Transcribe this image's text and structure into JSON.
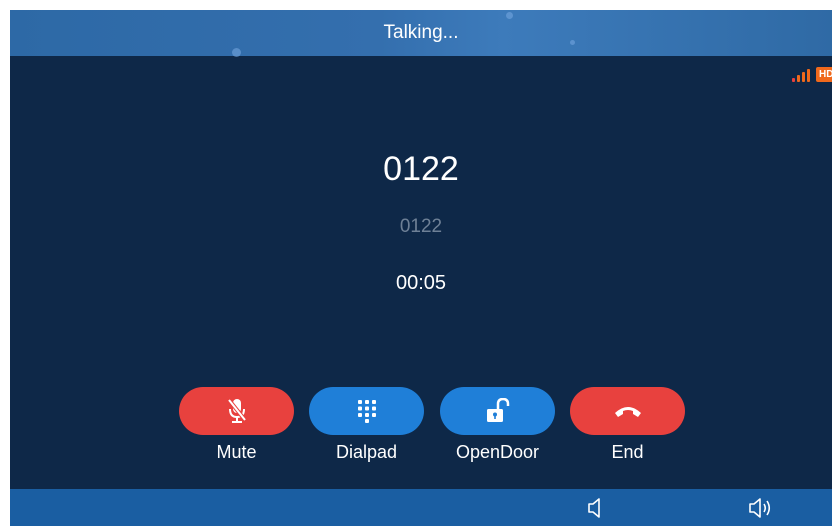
{
  "header": {
    "title": "Talking..."
  },
  "status": {
    "signal_icon": "signal-strength-icon",
    "hd_label": "HD",
    "hd_color": "#f0691c",
    "signal_active_color": "#e8413e",
    "signal_inactive_color": "#f0691c"
  },
  "call": {
    "number": "0122",
    "sub_number": "0122",
    "duration": "00:05"
  },
  "actions": {
    "mute_label": "Mute",
    "mute_icon": "microphone-muted-icon",
    "dialpad_label": "Dialpad",
    "dialpad_icon": "keypad-icon",
    "open_door_label": "OpenDoor",
    "open_door_icon": "unlock-icon",
    "end_label": "End",
    "end_icon": "hang-up-icon"
  },
  "bottom": {
    "volume_down_icon": "speaker-volume-down-icon",
    "volume_up_icon": "speaker-volume-up-icon"
  },
  "colors": {
    "background": "#0e2848",
    "danger": "#e8413e",
    "primary": "#1f7fd8",
    "bottom_bar": "#1a5ea2"
  }
}
